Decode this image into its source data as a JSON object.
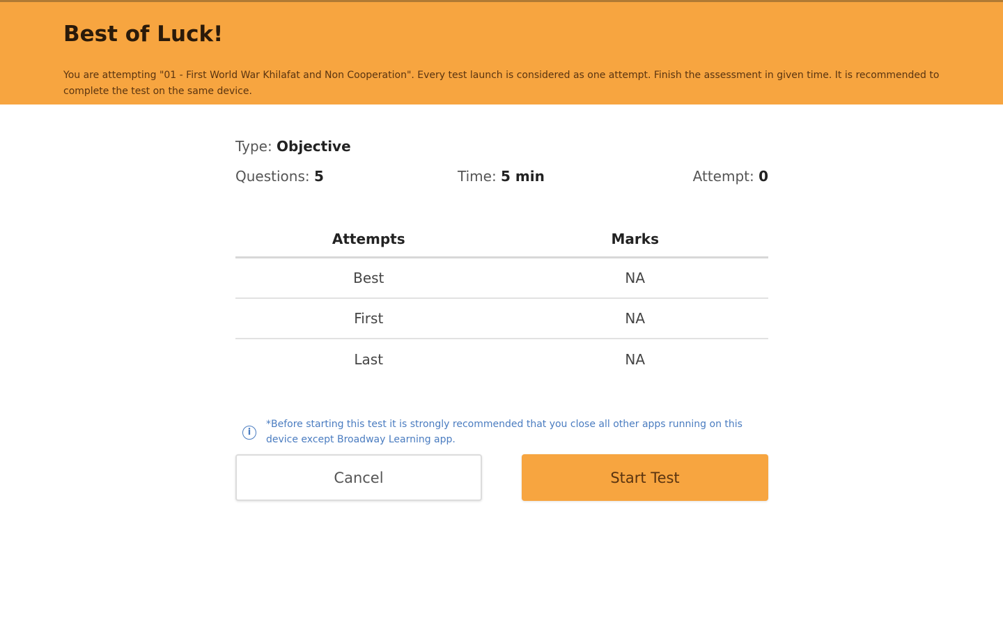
{
  "header": {
    "title": "Best of Luck!",
    "description": "You are attempting \"01 - First World War Khilafat and Non Cooperation\". Every test launch is considered as one attempt. Finish the assessment in given time. It is recommended to complete the test on the same device."
  },
  "test_info": {
    "type_label": "Type: ",
    "type_value": "Objective",
    "questions_label": "Questions: ",
    "questions_value": "5",
    "time_label": "Time: ",
    "time_value": "5 min",
    "attempt_label": "Attempt: ",
    "attempt_value": "0"
  },
  "table": {
    "headers": [
      "Attempts",
      "Marks"
    ],
    "rows": [
      {
        "attempt": "Best",
        "marks": "NA"
      },
      {
        "attempt": "First",
        "marks": "NA"
      },
      {
        "attempt": "Last",
        "marks": "NA"
      }
    ]
  },
  "notice": {
    "icon": "info-icon",
    "text": "*Before starting this test it is strongly recommended that you close all other apps running on this device except Broadway Learning app."
  },
  "buttons": {
    "cancel": "Cancel",
    "start": "Start Test"
  },
  "colors": {
    "accent": "#f7a540",
    "info": "#4a7cc0"
  }
}
